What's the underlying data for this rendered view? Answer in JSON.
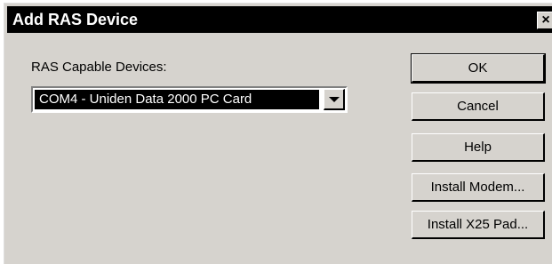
{
  "window": {
    "title": "Add RAS Device",
    "close_glyph": "×"
  },
  "devices": {
    "label": "RAS Capable Devices:",
    "selected": "COM4 - Uniden Data 2000 PC Card",
    "dropdown_icon": "chevron-down-icon"
  },
  "buttons": {
    "ok": "OK",
    "cancel": "Cancel",
    "help": "Help",
    "install_modem": "Install Modem...",
    "install_x25": "Install X25 Pad..."
  },
  "colors": {
    "titlebar": "#000000",
    "dialog_face": "#d6d3ce",
    "selection": "#000000"
  }
}
